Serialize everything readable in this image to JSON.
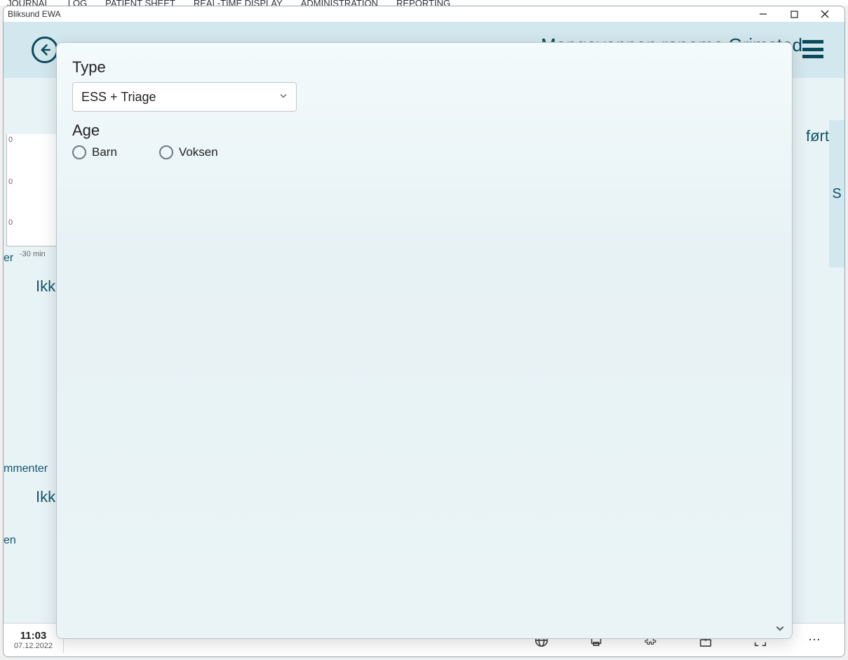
{
  "topMenu": [
    "JOURNAL",
    "LOG",
    "PATIENT SHEET",
    "REAL-TIME DISPLAY",
    "ADMINISTRATION",
    "REPORTING"
  ],
  "window": {
    "title": "Bliksund EWA"
  },
  "header": {
    "title": "Mongevannen roneme Grimstad"
  },
  "bg": {
    "rightTop": "ført",
    "rightMid": "S",
    "leftSide1": "er",
    "ikke1": "Ikk",
    "mmenter": "mmenter",
    "ikke2": "Ikk",
    "en": "en",
    "axis": {
      "y0a": "0",
      "y0b": "0",
      "y0c": "0",
      "x": "-30 min"
    }
  },
  "dialog": {
    "typeLabel": "Type",
    "typeValue": "ESS + Triage",
    "ageLabel": "Age",
    "radios": [
      {
        "label": "Barn"
      },
      {
        "label": "Voksen"
      }
    ]
  },
  "status": {
    "time": "11:03",
    "date": "07.12.2022"
  }
}
